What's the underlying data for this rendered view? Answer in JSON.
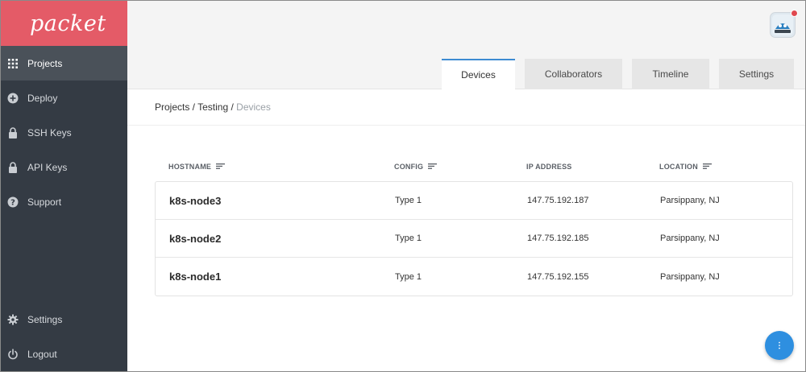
{
  "brand": {
    "logo_text": "packet",
    "color": "#e45b67"
  },
  "sidebar": {
    "items": [
      {
        "label": "Projects",
        "icon": "grid-icon",
        "active": true
      },
      {
        "label": "Deploy",
        "icon": "plus-circle-icon"
      },
      {
        "label": "SSH Keys",
        "icon": "lock-icon"
      },
      {
        "label": "API Keys",
        "icon": "lock-icon"
      },
      {
        "label": "Support",
        "icon": "help-circle-icon"
      }
    ],
    "bottom_items": [
      {
        "label": "Settings",
        "icon": "gear-icon"
      },
      {
        "label": "Logout",
        "icon": "power-icon"
      }
    ]
  },
  "tabs": [
    {
      "label": "Devices",
      "active": true
    },
    {
      "label": "Collaborators"
    },
    {
      "label": "Timeline"
    },
    {
      "label": "Settings"
    }
  ],
  "breadcrumb": {
    "path": "Projects / Testing / ",
    "current": "Devices"
  },
  "table": {
    "columns": [
      "HOSTNAME",
      "CONFIG",
      "IP ADDRESS",
      "LOCATION"
    ],
    "rows": [
      {
        "hostname": "k8s-node3",
        "config": "Type 1",
        "ip": "147.75.192.187",
        "location": "Parsippany, NJ"
      },
      {
        "hostname": "k8s-node2",
        "config": "Type 1",
        "ip": "147.75.192.185",
        "location": "Parsippany, NJ"
      },
      {
        "hostname": "k8s-node1",
        "config": "Type 1",
        "ip": "147.75.192.155",
        "location": "Parsippany, NJ"
      }
    ]
  },
  "colors": {
    "sidebar": "#343b44",
    "accent": "#3d8bd2",
    "fab": "#2e8fe0",
    "notification": "#e0484f"
  }
}
